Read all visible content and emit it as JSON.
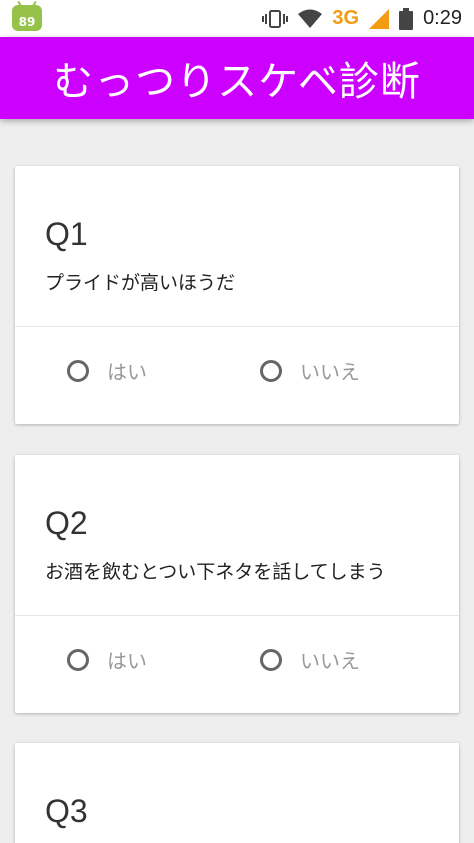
{
  "status_bar": {
    "notification_badge": "89",
    "network": "3G",
    "time": "0:29"
  },
  "app_bar": {
    "title": "むっつりスケベ診断"
  },
  "questions": [
    {
      "number": "Q1",
      "text": "プライドが高いほうだ",
      "yes_label": "はい",
      "no_label": "いいえ"
    },
    {
      "number": "Q2",
      "text": "お酒を飲むとつい下ネタを話してしまう",
      "yes_label": "はい",
      "no_label": "いいえ"
    },
    {
      "number": "Q3"
    }
  ],
  "colors": {
    "app_bar": "#cc00ff",
    "network": "#f39c12"
  }
}
